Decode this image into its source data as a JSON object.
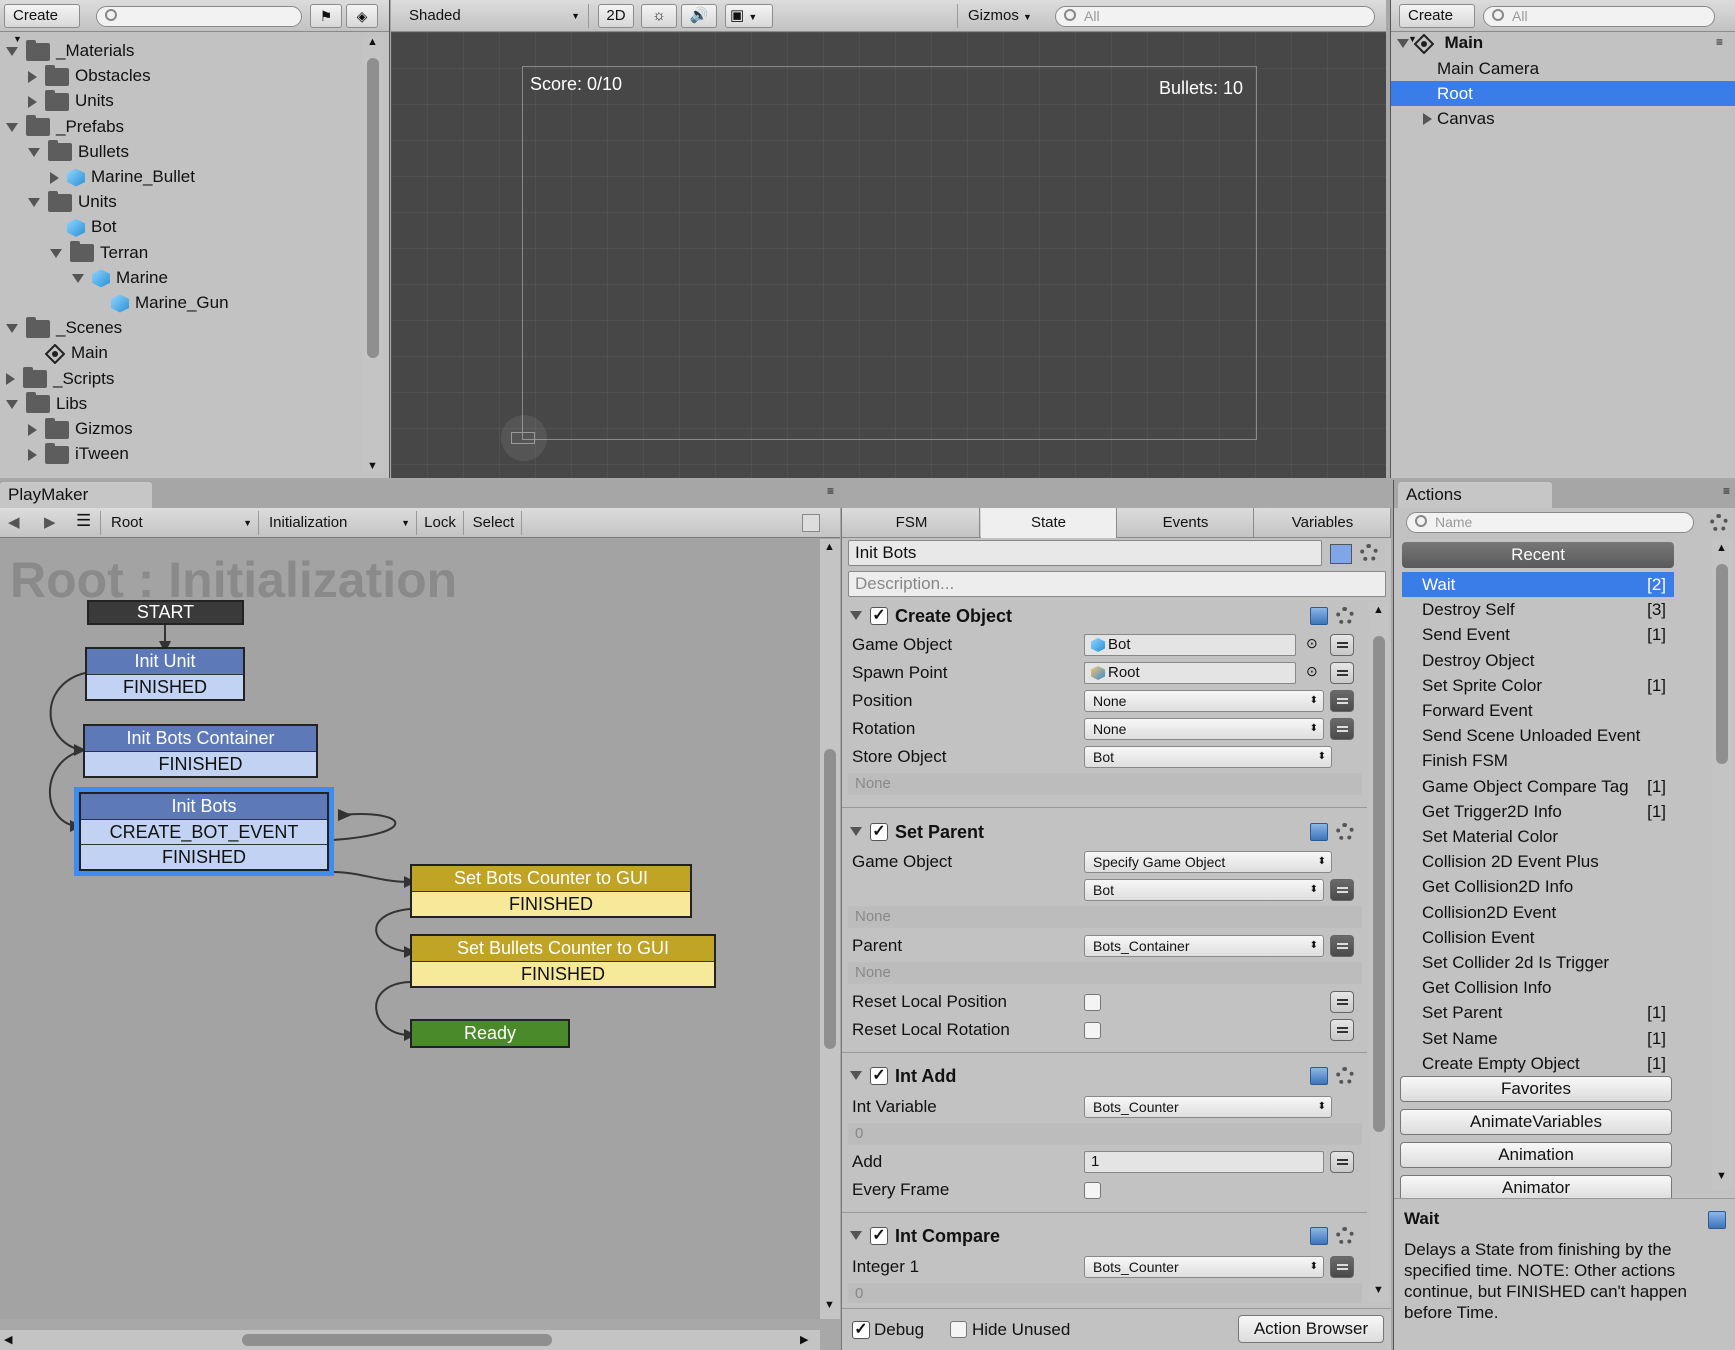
{
  "project": {
    "create_label": "Create",
    "search_placeholder": "",
    "items": [
      {
        "label": "_Materials",
        "type": "folder",
        "expanded": true
      },
      {
        "label": "Obstacles",
        "type": "folder",
        "expanded": false
      },
      {
        "label": "Units",
        "type": "folder",
        "expanded": false
      },
      {
        "label": "_Prefabs",
        "type": "folder",
        "expanded": true
      },
      {
        "label": "Bullets",
        "type": "folder",
        "expanded": true
      },
      {
        "label": "Marine_Bullet",
        "type": "prefab",
        "expanded": false
      },
      {
        "label": "Units",
        "type": "folder",
        "expanded": true
      },
      {
        "label": "Bot",
        "type": "prefab"
      },
      {
        "label": "Terran",
        "type": "folder",
        "expanded": true
      },
      {
        "label": "Marine",
        "type": "prefab",
        "expanded": true
      },
      {
        "label": "Marine_Gun",
        "type": "prefab"
      },
      {
        "label": "_Scenes",
        "type": "folder",
        "expanded": true
      },
      {
        "label": "Main",
        "type": "scene"
      },
      {
        "label": "_Scripts",
        "type": "folder",
        "expanded": false
      },
      {
        "label": "Libs",
        "type": "folder",
        "expanded": true
      },
      {
        "label": "Gizmos",
        "type": "folder",
        "expanded": false
      },
      {
        "label": "iTween",
        "type": "folder",
        "expanded": false
      }
    ]
  },
  "scene": {
    "shading_mode": "Shaded",
    "mode_2d": "2D",
    "gizmos_label": "Gizmos",
    "search_placeholder": "All",
    "score_text": "Score: 0/10",
    "bullets_text": "Bullets: 10"
  },
  "hierarchy": {
    "create_label": "Create",
    "search_placeholder": "All",
    "scene_name": "Main",
    "items": [
      "Main Camera",
      "Root",
      "Canvas"
    ],
    "selected": "Root"
  },
  "playmaker": {
    "tab_label": "PlayMaker",
    "fsm_owner": "Root",
    "fsm_name": "Initialization",
    "lock_label": "Lock",
    "select_label": "Select",
    "graph_title": "Root : Initialization",
    "start_label": "START",
    "states": [
      {
        "name": "Init Unit",
        "events": [
          "FINISHED"
        ]
      },
      {
        "name": "Init Bots Container",
        "events": [
          "FINISHED"
        ]
      },
      {
        "name": "Init Bots",
        "events": [
          "CREATE_BOT_EVENT",
          "FINISHED"
        ]
      },
      {
        "name": "Set Bots Counter to GUI",
        "events": [
          "FINISHED"
        ]
      },
      {
        "name": "Set Bullets Counter to GUI",
        "events": [
          "FINISHED"
        ]
      },
      {
        "name": "Ready",
        "events": []
      }
    ],
    "colors": {
      "blue": "#5d79b8",
      "blue_event": "#c2d2f2",
      "yellow": "#bfa426",
      "yellow_event": "#f6e99a",
      "green": "#4a8a2a",
      "selected": "#3f8cf0"
    }
  },
  "inspector": {
    "tabs": [
      "FSM",
      "State",
      "Events",
      "Variables"
    ],
    "active_tab": "State",
    "state_name": "Init Bots",
    "description_placeholder": "Description...",
    "actions": [
      {
        "title": "Create Object",
        "fields": [
          {
            "label": "Game Object",
            "value": "Bot"
          },
          {
            "label": "Spawn Point",
            "value": "Root"
          },
          {
            "label": "Position",
            "value": "None"
          },
          {
            "label": "Rotation",
            "value": "None"
          },
          {
            "label": "Store Object",
            "value": "Bot"
          }
        ],
        "none_text": "None"
      },
      {
        "title": "Set Parent",
        "fields": [
          {
            "label": "Game Object",
            "value": "Specify Game Object"
          },
          {
            "label": "",
            "value": "Bot"
          },
          {
            "label": "Parent",
            "value": "Bots_Container"
          },
          {
            "label": "Reset Local Position",
            "value": ""
          },
          {
            "label": "Reset Local Rotation",
            "value": ""
          }
        ],
        "none_text": "None"
      },
      {
        "title": "Int Add",
        "fields": [
          {
            "label": "Int Variable",
            "value": "Bots_Counter"
          },
          {
            "label": "Add",
            "value": "1"
          },
          {
            "label": "Every Frame",
            "value": ""
          }
        ],
        "zero_text": "0"
      },
      {
        "title": "Int Compare",
        "fields": [
          {
            "label": "Integer 1",
            "value": "Bots_Counter"
          }
        ],
        "zero_text": "0"
      }
    ],
    "debug_label": "Debug",
    "hide_unused_label": "Hide Unused",
    "action_browser_label": "Action Browser"
  },
  "actions_panel": {
    "tab_label": "Actions",
    "search_placeholder": "Name",
    "recent_label": "Recent",
    "recent": [
      {
        "name": "Wait",
        "count": "[2]"
      },
      {
        "name": "Destroy Self",
        "count": "[3]"
      },
      {
        "name": "Send Event",
        "count": "[1]"
      },
      {
        "name": "Destroy Object",
        "count": ""
      },
      {
        "name": "Set Sprite Color",
        "count": "[1]"
      },
      {
        "name": "Forward Event",
        "count": ""
      },
      {
        "name": "Send Scene Unloaded Event",
        "count": ""
      },
      {
        "name": "Finish FSM",
        "count": ""
      },
      {
        "name": "Game Object Compare Tag",
        "count": "[1]"
      },
      {
        "name": "Get Trigger2D Info",
        "count": "[1]"
      },
      {
        "name": "Set Material Color",
        "count": ""
      },
      {
        "name": "Collision 2D Event Plus",
        "count": ""
      },
      {
        "name": "Get Collision2D Info",
        "count": ""
      },
      {
        "name": "Collision2D Event",
        "count": ""
      },
      {
        "name": "Collision Event",
        "count": ""
      },
      {
        "name": "Set Collider 2d Is Trigger",
        "count": ""
      },
      {
        "name": "Get Collision Info",
        "count": ""
      },
      {
        "name": "Set Parent",
        "count": "[1]"
      },
      {
        "name": "Set Name",
        "count": "[1]"
      },
      {
        "name": "Create Empty Object",
        "count": "[1]"
      }
    ],
    "categories": [
      "Favorites",
      "AnimateVariables",
      "Animation",
      "Animator"
    ],
    "help_title": "Wait",
    "help_text": "Delays a State from finishing by the specified time. NOTE: Other actions continue, but FINISHED can't happen before Time."
  }
}
